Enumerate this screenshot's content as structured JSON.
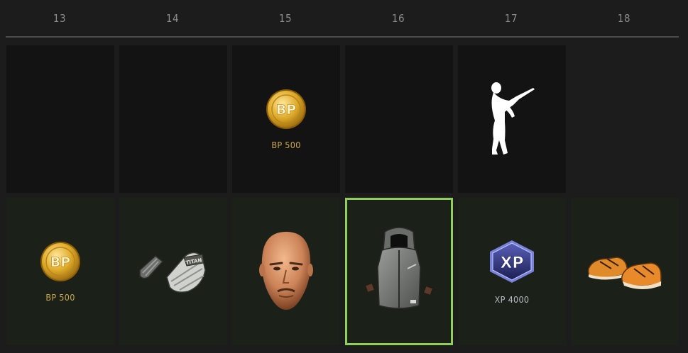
{
  "days": [
    "13",
    "14",
    "15",
    "16",
    "17",
    "18"
  ],
  "free_track": [
    {
      "day": "13",
      "item": "empty"
    },
    {
      "day": "14",
      "item": "empty"
    },
    {
      "day": "15",
      "item": "bp-coin",
      "label": "BP 500"
    },
    {
      "day": "16",
      "item": "empty"
    },
    {
      "day": "17",
      "item": "emote-pose-icon"
    },
    {
      "day": "18",
      "item": "empty"
    }
  ],
  "premium_track": [
    {
      "day": "13",
      "item": "bp-coin",
      "label": "BP 500"
    },
    {
      "day": "14",
      "item": "wrapped-gloves-icon",
      "glove_text": "TITAN"
    },
    {
      "day": "15",
      "item": "bald-head-face-icon"
    },
    {
      "day": "16",
      "item": "hooded-vest-icon",
      "selected": true
    },
    {
      "day": "17",
      "item": "xp-badge",
      "label": "XP 4000",
      "badge_text": "XP"
    },
    {
      "day": "18",
      "item": "orange-sneakers-icon"
    }
  ],
  "coin_text": "BP",
  "colors": {
    "accent_selected": "#8fce5a",
    "bp_gold": "#c9a648",
    "free_bg": "#131313",
    "premium_bg": "#1b2119",
    "xp_label": "#b9bcc4"
  }
}
